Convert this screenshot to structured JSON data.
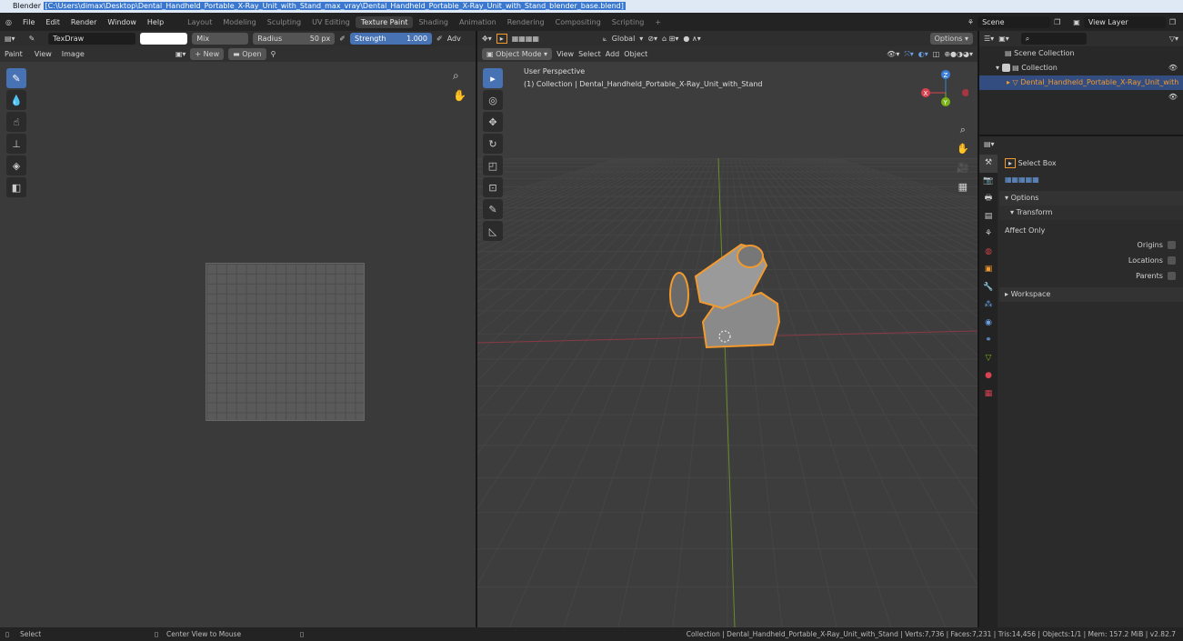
{
  "window": {
    "title_prefix": "Blender ",
    "title_path": "[C:\\Users\\dimax\\Desktop\\Dental_Handheld_Portable_X-Ray_Unit_with_Stand_max_vray\\Dental_Handheld_Portable_X-Ray_Unit_with_Stand_blender_base.blend]"
  },
  "menu": [
    "File",
    "Edit",
    "Render",
    "Window",
    "Help"
  ],
  "workspaces": [
    "Layout",
    "Modeling",
    "Sculpting",
    "UV Editing",
    "Texture Paint",
    "Shading",
    "Animation",
    "Rendering",
    "Compositing",
    "Scripting"
  ],
  "active_workspace": "Texture Paint",
  "scene": "Scene",
  "view_layer": "View Layer",
  "paint_toolbar": {
    "brush": "TexDraw",
    "blend": "Mix",
    "radius_label": "Radius",
    "radius": "50 px",
    "strength_label": "Strength",
    "strength": "1.000",
    "advanced": "Adv"
  },
  "image_header": {
    "mode": "Paint",
    "view": "View",
    "image": "Image",
    "new": "New",
    "open": "Open"
  },
  "viewport_header": {
    "mode": "Object Mode",
    "view": "View",
    "select": "Select",
    "add": "Add",
    "object": "Object",
    "orientation": "Global",
    "options": "Options"
  },
  "viewport": {
    "perspective": "User Perspective",
    "collection_info": "(1) Collection | Dental_Handheld_Portable_X-Ray_Unit_with_Stand",
    "gizmo": {
      "x": "X",
      "y": "Y",
      "z": "Z"
    }
  },
  "outliner": {
    "scene_collection": "Scene Collection",
    "collection": "Collection",
    "object": "Dental_Handheld_Portable_X-Ray_Unit_with"
  },
  "properties": {
    "tool": "Select Box",
    "options": "Options",
    "transform": "Transform",
    "affect_only": "Affect Only",
    "origins": "Origins",
    "locations": "Locations",
    "parents": "Parents",
    "workspace": "Workspace"
  },
  "status": {
    "select": "Select",
    "center": "Center View to Mouse",
    "info": "Collection | Dental_Handheld_Portable_X-Ray_Unit_with_Stand | Verts:7,736 | Faces:7,231 | Tris:14,456 | Objects:1/1 | Mem: 157.2 MiB | v2.82.7"
  },
  "colors": {
    "accent": "#4772b3",
    "selection": "#f29a2e",
    "x_axis": "#d9424f",
    "y_axis": "#7ab317",
    "z_axis": "#3b7fd9"
  }
}
